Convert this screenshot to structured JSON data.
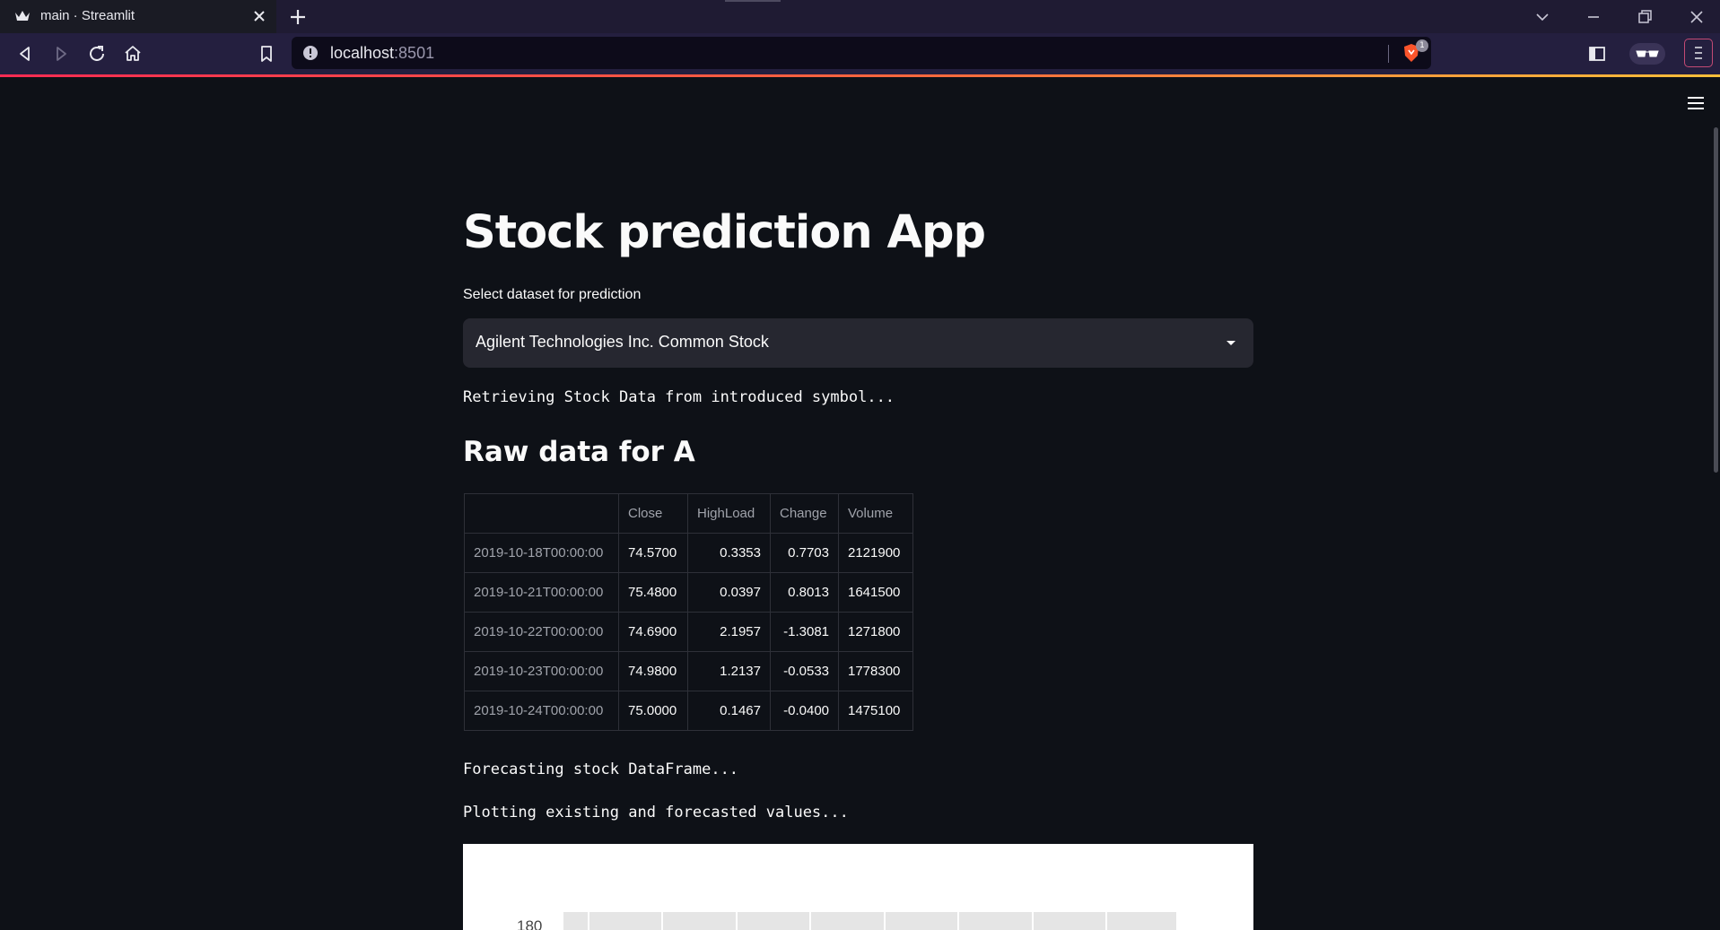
{
  "browser": {
    "tab_title": "main · Streamlit",
    "url_host": "localhost",
    "url_port": ":8501",
    "shield_badge": "1"
  },
  "app": {
    "title": "Stock prediction App",
    "select_label": "Select dataset for prediction",
    "select_value": "Agilent Technologies Inc. Common Stock",
    "status_retrieving": "Retrieving Stock Data from introduced symbol...",
    "raw_data_header": "Raw data for A",
    "status_forecasting": "Forecasting stock DataFrame...",
    "status_plotting": "Plotting existing and forecasted values..."
  },
  "table": {
    "columns": [
      "",
      "Close",
      "HighLoad",
      "Change",
      "Volume"
    ],
    "rows": [
      [
        "2019-10-18T00:00:00",
        "74.5700",
        "0.3353",
        "0.7703",
        "2121900"
      ],
      [
        "2019-10-21T00:00:00",
        "75.4800",
        "0.0397",
        "0.8013",
        "1641500"
      ],
      [
        "2019-10-22T00:00:00",
        "74.6900",
        "2.1957",
        "-1.3081",
        "1271800"
      ],
      [
        "2019-10-23T00:00:00",
        "74.9800",
        "1.2137",
        "-0.0533",
        "1778300"
      ],
      [
        "2019-10-24T00:00:00",
        "75.0000",
        "0.1467",
        "-0.0400",
        "1475100"
      ]
    ]
  },
  "chart": {
    "first_ytick": "180"
  }
}
